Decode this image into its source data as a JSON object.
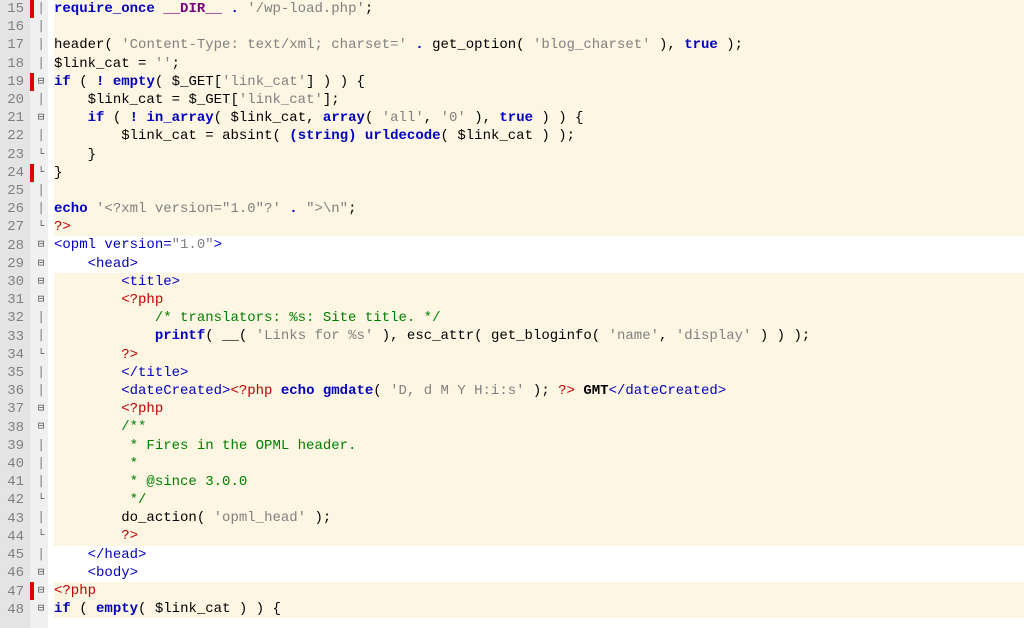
{
  "first_line": 15,
  "lines": [
    {
      "n": 15,
      "hl": true,
      "fold": "|",
      "change": "red",
      "tokens": [
        {
          "t": "require_once",
          "c": "kw"
        },
        {
          "t": " "
        },
        {
          "t": "__DIR__",
          "c": "const"
        },
        {
          "t": " "
        },
        {
          "t": ".",
          "c": "kw"
        },
        {
          "t": " "
        },
        {
          "t": "'/wp-load.php'",
          "c": "str"
        },
        {
          "t": ";",
          "c": "punct"
        }
      ]
    },
    {
      "n": 16,
      "hl": true,
      "fold": "|",
      "tokens": []
    },
    {
      "n": 17,
      "hl": true,
      "fold": "|",
      "tokens": [
        {
          "t": "header",
          "c": "fn"
        },
        {
          "t": "( "
        },
        {
          "t": "'Content-Type: text/xml; charset='",
          "c": "str"
        },
        {
          "t": " "
        },
        {
          "t": ".",
          "c": "kw"
        },
        {
          "t": " "
        },
        {
          "t": "get_option",
          "c": "fn"
        },
        {
          "t": "( "
        },
        {
          "t": "'blog_charset'",
          "c": "str"
        },
        {
          "t": " )"
        },
        {
          "t": ","
        },
        {
          "t": " "
        },
        {
          "t": "true",
          "c": "kw"
        },
        {
          "t": " )"
        },
        {
          "t": ";"
        }
      ]
    },
    {
      "n": 18,
      "hl": true,
      "fold": "|",
      "tokens": [
        {
          "t": "$link_cat",
          "c": "fn"
        },
        {
          "t": " = "
        },
        {
          "t": "''",
          "c": "str"
        },
        {
          "t": ";"
        }
      ]
    },
    {
      "n": 19,
      "hl": true,
      "fold": "⊟",
      "change": "red",
      "tokens": [
        {
          "t": "if",
          "c": "kw"
        },
        {
          "t": " ( "
        },
        {
          "t": "!",
          "c": "kw"
        },
        {
          "t": " "
        },
        {
          "t": "empty",
          "c": "kw"
        },
        {
          "t": "( "
        },
        {
          "t": "$_GET",
          "c": "fn"
        },
        {
          "t": "["
        },
        {
          "t": "'link_cat'",
          "c": "str"
        },
        {
          "t": "] ) ) {"
        }
      ]
    },
    {
      "n": 20,
      "hl": true,
      "fold": "|",
      "tokens": [
        {
          "t": "    "
        },
        {
          "t": "$link_cat",
          "c": "fn"
        },
        {
          "t": " = "
        },
        {
          "t": "$_GET",
          "c": "fn"
        },
        {
          "t": "["
        },
        {
          "t": "'link_cat'",
          "c": "str"
        },
        {
          "t": "];"
        }
      ]
    },
    {
      "n": 21,
      "hl": true,
      "fold": "⊟",
      "tokens": [
        {
          "t": "    "
        },
        {
          "t": "if",
          "c": "kw"
        },
        {
          "t": " ( "
        },
        {
          "t": "!",
          "c": "kw"
        },
        {
          "t": " "
        },
        {
          "t": "in_array",
          "c": "kw2"
        },
        {
          "t": "( "
        },
        {
          "t": "$link_cat",
          "c": "fn"
        },
        {
          "t": ", "
        },
        {
          "t": "array",
          "c": "kw"
        },
        {
          "t": "( "
        },
        {
          "t": "'all'",
          "c": "str"
        },
        {
          "t": ", "
        },
        {
          "t": "'0'",
          "c": "str"
        },
        {
          "t": " ), "
        },
        {
          "t": "true",
          "c": "kw"
        },
        {
          "t": " ) ) {"
        }
      ]
    },
    {
      "n": 22,
      "hl": true,
      "fold": "|",
      "tokens": [
        {
          "t": "        "
        },
        {
          "t": "$link_cat",
          "c": "fn"
        },
        {
          "t": " = "
        },
        {
          "t": "absint",
          "c": "fn"
        },
        {
          "t": "( "
        },
        {
          "t": "(string)",
          "c": "kw"
        },
        {
          "t": " "
        },
        {
          "t": "urldecode",
          "c": "kw2"
        },
        {
          "t": "( "
        },
        {
          "t": "$link_cat",
          "c": "fn"
        },
        {
          "t": " ) );"
        }
      ]
    },
    {
      "n": 23,
      "hl": true,
      "fold": "-",
      "tokens": [
        {
          "t": "    }"
        }
      ]
    },
    {
      "n": 24,
      "hl": true,
      "fold": "-",
      "change": "red",
      "tokens": [
        {
          "t": "}"
        }
      ]
    },
    {
      "n": 25,
      "hl": true,
      "fold": "|",
      "tokens": []
    },
    {
      "n": 26,
      "hl": true,
      "fold": "|",
      "tokens": [
        {
          "t": "echo",
          "c": "kw"
        },
        {
          "t": " "
        },
        {
          "t": "'<?xml version=\"1.0\"?'",
          "c": "str"
        },
        {
          "t": " "
        },
        {
          "t": ".",
          "c": "kw"
        },
        {
          "t": " "
        },
        {
          "t": "\">\\n\"",
          "c": "str"
        },
        {
          "t": ";"
        }
      ]
    },
    {
      "n": 27,
      "hl": true,
      "fold": "-",
      "tokens": [
        {
          "t": "?>",
          "c": "phpt"
        }
      ]
    },
    {
      "n": 28,
      "fold": "⊟",
      "tokens": [
        {
          "t": "<opml version=",
          "c": "tag"
        },
        {
          "t": "\"1.0\"",
          "c": "str"
        },
        {
          "t": ">",
          "c": "tag"
        }
      ]
    },
    {
      "n": 29,
      "fold": "⊟",
      "tokens": [
        {
          "t": "    "
        },
        {
          "t": "<head>",
          "c": "tag"
        }
      ]
    },
    {
      "n": 30,
      "hl": true,
      "fold": "⊟",
      "tokens": [
        {
          "t": "        "
        },
        {
          "t": "<title>",
          "c": "tag"
        }
      ]
    },
    {
      "n": 31,
      "hl": true,
      "fold": "⊟",
      "tokens": [
        {
          "t": "        "
        },
        {
          "t": "<?php",
          "c": "phpt"
        }
      ]
    },
    {
      "n": 32,
      "hl": true,
      "fold": "|",
      "tokens": [
        {
          "t": "            "
        },
        {
          "t": "/* translators: %s: Site title. */",
          "c": "com"
        }
      ]
    },
    {
      "n": 33,
      "hl": true,
      "fold": "|",
      "tokens": [
        {
          "t": "            "
        },
        {
          "t": "printf",
          "c": "kw2"
        },
        {
          "t": "( "
        },
        {
          "t": "__",
          "c": "fn"
        },
        {
          "t": "( "
        },
        {
          "t": "'Links for %s'",
          "c": "str"
        },
        {
          "t": " ), "
        },
        {
          "t": "esc_attr",
          "c": "fn"
        },
        {
          "t": "( "
        },
        {
          "t": "get_bloginfo",
          "c": "fn"
        },
        {
          "t": "( "
        },
        {
          "t": "'name'",
          "c": "str"
        },
        {
          "t": ", "
        },
        {
          "t": "'display'",
          "c": "str"
        },
        {
          "t": " ) ) );"
        }
      ]
    },
    {
      "n": 34,
      "hl": true,
      "fold": "-",
      "tokens": [
        {
          "t": "        "
        },
        {
          "t": "?>",
          "c": "phpt"
        }
      ]
    },
    {
      "n": 35,
      "hl": true,
      "fold": "|",
      "tokens": [
        {
          "t": "        "
        },
        {
          "t": "</title>",
          "c": "tag"
        }
      ]
    },
    {
      "n": 36,
      "hl": true,
      "fold": "|",
      "tokens": [
        {
          "t": "        "
        },
        {
          "t": "<dateCreated>",
          "c": "tag"
        },
        {
          "t": "<?php",
          "c": "phpt"
        },
        {
          "t": " "
        },
        {
          "t": "echo",
          "c": "kw"
        },
        {
          "t": " "
        },
        {
          "t": "gmdate",
          "c": "kw2"
        },
        {
          "t": "( "
        },
        {
          "t": "'D, d M Y H:i:s'",
          "c": "str"
        },
        {
          "t": " ); "
        },
        {
          "t": "?>",
          "c": "phpt"
        },
        {
          "t": " "
        },
        {
          "t": "GMT",
          "c": "bold"
        },
        {
          "t": "</dateCreated>",
          "c": "tag"
        }
      ]
    },
    {
      "n": 37,
      "hl": true,
      "fold": "⊟",
      "tokens": [
        {
          "t": "        "
        },
        {
          "t": "<?php",
          "c": "phpt"
        }
      ]
    },
    {
      "n": 38,
      "hl": true,
      "fold": "⊟",
      "tokens": [
        {
          "t": "        "
        },
        {
          "t": "/**",
          "c": "com"
        }
      ]
    },
    {
      "n": 39,
      "hl": true,
      "fold": "|",
      "tokens": [
        {
          "t": "         "
        },
        {
          "t": "* Fires in the OPML header.",
          "c": "com"
        }
      ]
    },
    {
      "n": 40,
      "hl": true,
      "fold": "|",
      "tokens": [
        {
          "t": "         "
        },
        {
          "t": "*",
          "c": "com"
        }
      ]
    },
    {
      "n": 41,
      "hl": true,
      "fold": "|",
      "tokens": [
        {
          "t": "         "
        },
        {
          "t": "* @since 3.0.0",
          "c": "com"
        }
      ]
    },
    {
      "n": 42,
      "hl": true,
      "fold": "-",
      "tokens": [
        {
          "t": "         "
        },
        {
          "t": "*/",
          "c": "com"
        }
      ]
    },
    {
      "n": 43,
      "hl": true,
      "fold": "|",
      "tokens": [
        {
          "t": "        "
        },
        {
          "t": "do_action",
          "c": "fn"
        },
        {
          "t": "( "
        },
        {
          "t": "'opml_head'",
          "c": "str"
        },
        {
          "t": " );"
        }
      ]
    },
    {
      "n": 44,
      "hl": true,
      "fold": "-",
      "tokens": [
        {
          "t": "        "
        },
        {
          "t": "?>",
          "c": "phpt"
        }
      ]
    },
    {
      "n": 45,
      "fold": "|",
      "tokens": [
        {
          "t": "    "
        },
        {
          "t": "</head>",
          "c": "tag"
        }
      ]
    },
    {
      "n": 46,
      "fold": "⊟",
      "tokens": [
        {
          "t": "    "
        },
        {
          "t": "<body>",
          "c": "tag"
        }
      ]
    },
    {
      "n": 47,
      "hl": true,
      "fold": "⊟",
      "change": "red",
      "tokens": [
        {
          "t": "<?php",
          "c": "phpt"
        }
      ]
    },
    {
      "n": 48,
      "hl": true,
      "fold": "⊟",
      "tokens": [
        {
          "t": "if",
          "c": "kw"
        },
        {
          "t": " ( "
        },
        {
          "t": "empty",
          "c": "kw"
        },
        {
          "t": "( "
        },
        {
          "t": "$link_cat",
          "c": "fn"
        },
        {
          "t": " ) ) {"
        }
      ]
    }
  ]
}
